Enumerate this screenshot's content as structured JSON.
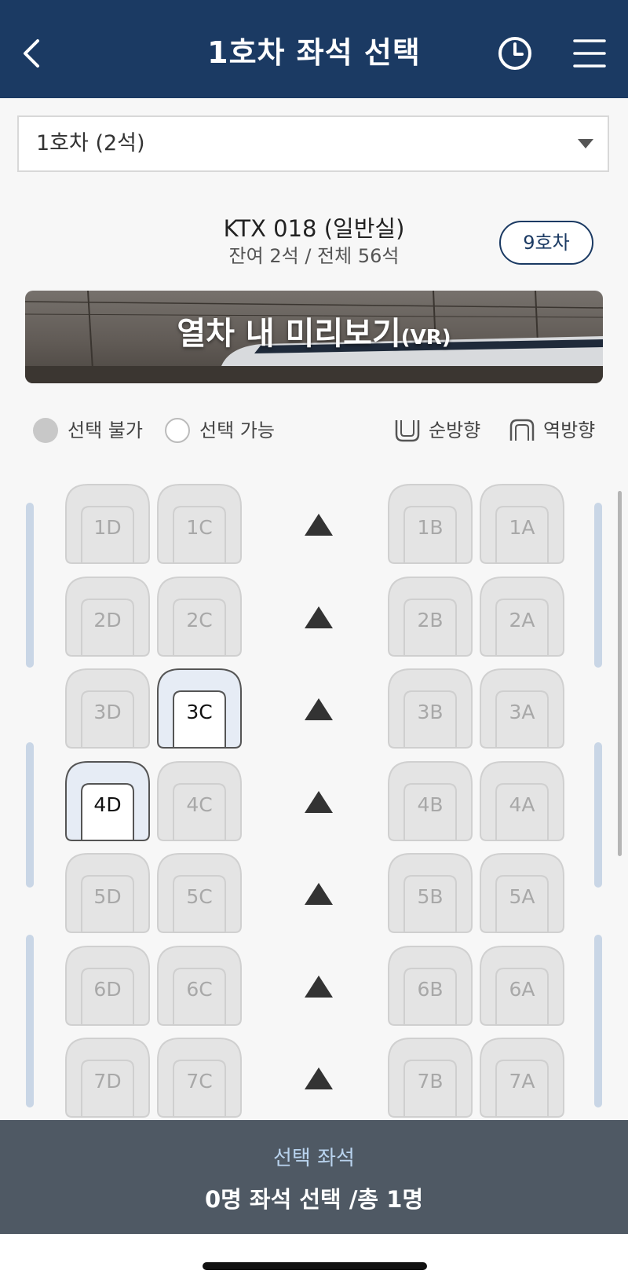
{
  "header": {
    "title": "1호차 좌석 선택",
    "icons": [
      "back-icon",
      "clock-icon",
      "menu-icon"
    ]
  },
  "car_select": {
    "value": "1호차 (2석)"
  },
  "train": {
    "name": "KTX 018 (일반실)",
    "summary": "잔여 2석 / 전체 56석",
    "car_button": "9호차"
  },
  "vr": {
    "title": "열차 내 미리보기",
    "suffix": "(VR)"
  },
  "legend": {
    "unavailable": "선택 불가",
    "available": "선택 가능",
    "forward": "순방향",
    "reverse": "역방향"
  },
  "seats": [
    [
      {
        "id": "1D",
        "available": false
      },
      {
        "id": "1C",
        "available": false
      },
      {
        "id": "1B",
        "available": false
      },
      {
        "id": "1A",
        "available": false
      }
    ],
    [
      {
        "id": "2D",
        "available": false
      },
      {
        "id": "2C",
        "available": false
      },
      {
        "id": "2B",
        "available": false
      },
      {
        "id": "2A",
        "available": false
      }
    ],
    [
      {
        "id": "3D",
        "available": false
      },
      {
        "id": "3C",
        "available": true
      },
      {
        "id": "3B",
        "available": false
      },
      {
        "id": "3A",
        "available": false
      }
    ],
    [
      {
        "id": "4D",
        "available": true
      },
      {
        "id": "4C",
        "available": false
      },
      {
        "id": "4B",
        "available": false
      },
      {
        "id": "4A",
        "available": false
      }
    ],
    [
      {
        "id": "5D",
        "available": false
      },
      {
        "id": "5C",
        "available": false
      },
      {
        "id": "5B",
        "available": false
      },
      {
        "id": "5A",
        "available": false
      }
    ],
    [
      {
        "id": "6D",
        "available": false
      },
      {
        "id": "6C",
        "available": false
      },
      {
        "id": "6B",
        "available": false
      },
      {
        "id": "6A",
        "available": false
      }
    ],
    [
      {
        "id": "7D",
        "available": false
      },
      {
        "id": "7C",
        "available": false
      },
      {
        "id": "7B",
        "available": false
      },
      {
        "id": "7A",
        "available": false
      }
    ]
  ],
  "bottom": {
    "label": "선택 좌석",
    "status": "0명 좌석 선택 /총 1명"
  },
  "colors": {
    "header_bg": "#1b3a63",
    "unavailable_seat": "#e4e4e4",
    "available_seat_border": "#555555",
    "available_seat_fill": "#e6ecf5",
    "bottom_bar": "#4f5964",
    "accent_text": "#b9d3ee"
  }
}
